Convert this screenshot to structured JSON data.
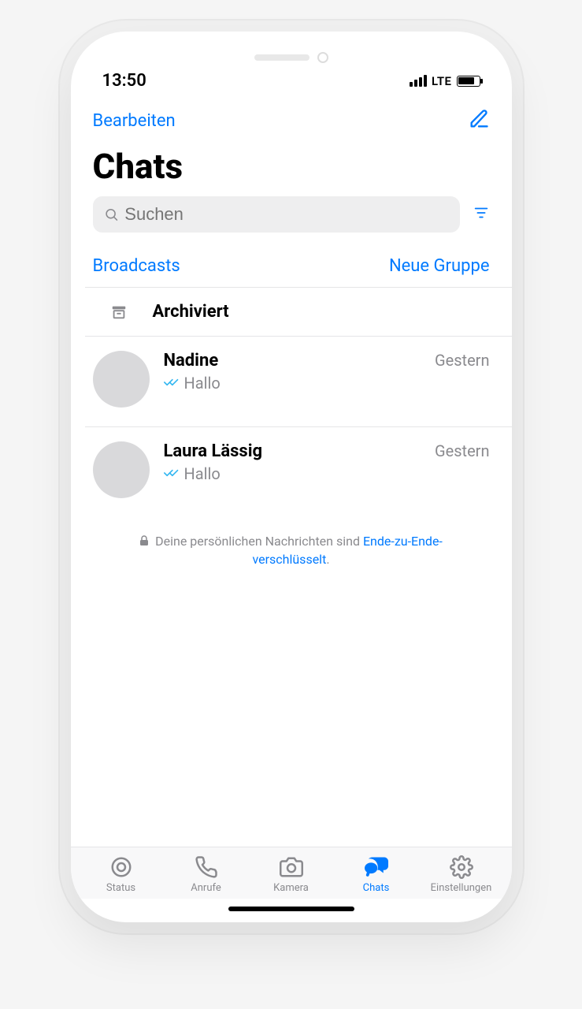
{
  "status": {
    "time": "13:50",
    "network": "LTE"
  },
  "header": {
    "edit": "Bearbeiten",
    "compose_icon": "compose-icon"
  },
  "title": "Chats",
  "search": {
    "placeholder": "Suchen",
    "filter_icon": "filter-icon"
  },
  "subnav": {
    "broadcasts": "Broadcasts",
    "new_group": "Neue Gruppe"
  },
  "archived": {
    "label": "Archiviert"
  },
  "chats": [
    {
      "name": "Nadine",
      "time": "Gestern",
      "message": "Hallo",
      "read": true
    },
    {
      "name": "Laura Lässig",
      "time": "Gestern",
      "message": "Hallo",
      "read": true
    }
  ],
  "e2e": {
    "prefix": "Deine persönlichen Nachrichten sind ",
    "link": "Ende-zu-Ende-verschlüsselt",
    "suffix": "."
  },
  "tabs": [
    {
      "label": "Status",
      "active": false
    },
    {
      "label": "Anrufe",
      "active": false
    },
    {
      "label": "Kamera",
      "active": false
    },
    {
      "label": "Chats",
      "active": true
    },
    {
      "label": "Einstellungen",
      "active": false
    }
  ]
}
